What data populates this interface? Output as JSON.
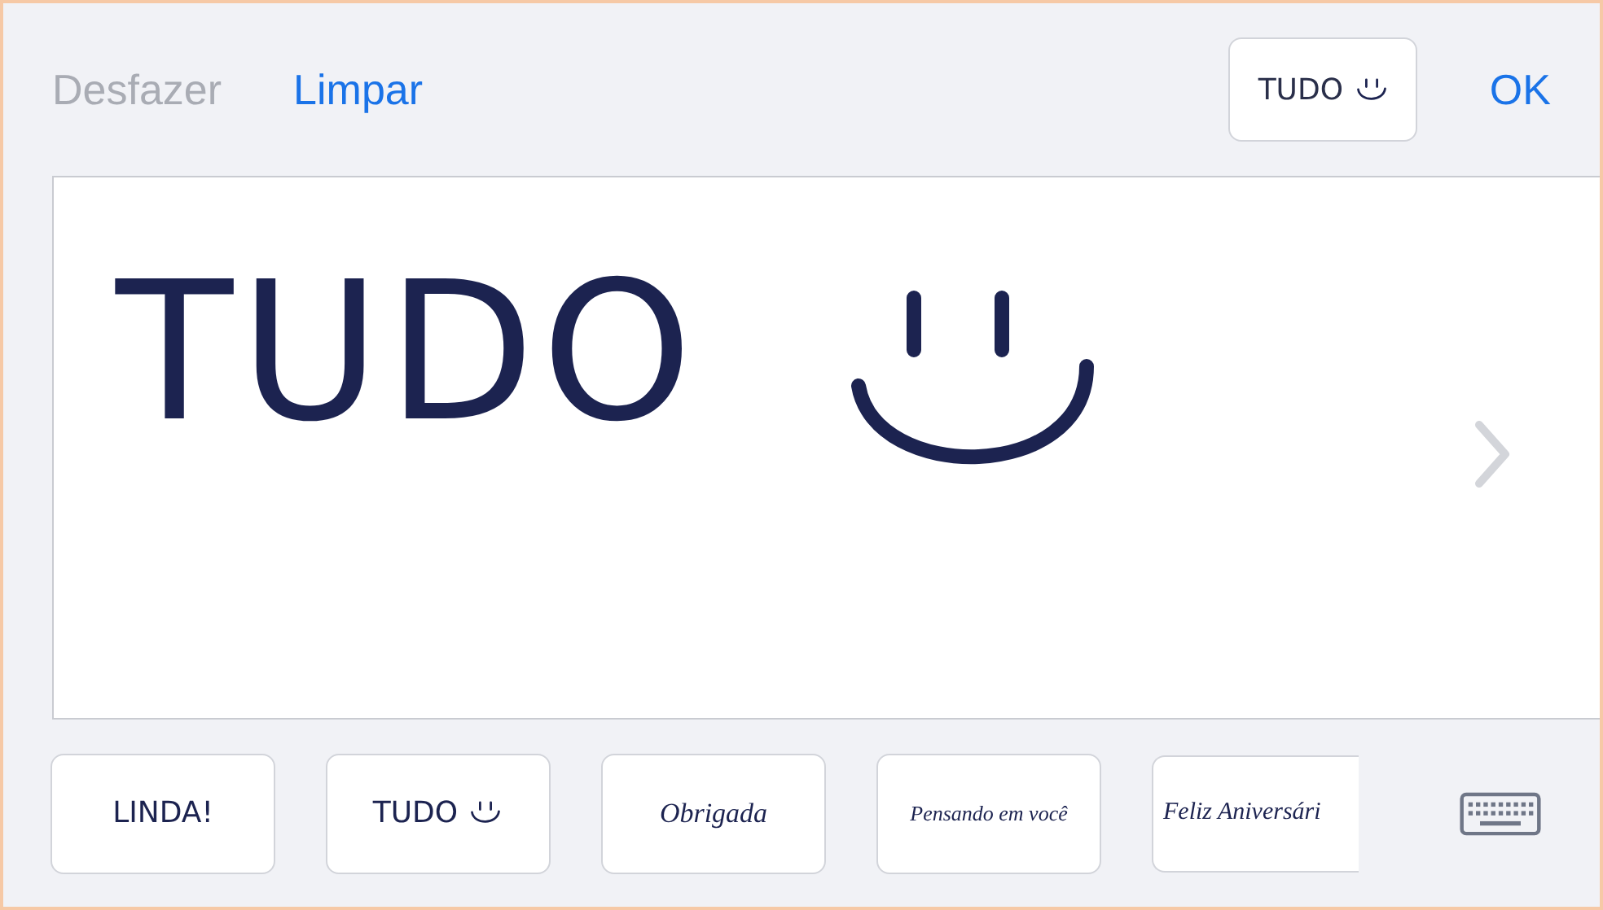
{
  "toolbar": {
    "undo": {
      "label": "Desfazer",
      "disabled": true
    },
    "clear": {
      "label": "Limpar",
      "disabled": false
    },
    "preview": {
      "text": "TUDO",
      "smiley": true
    },
    "done": {
      "label": "OK"
    }
  },
  "canvas": {
    "text": "TUDO",
    "smiley": true
  },
  "suggestions": [
    {
      "text": "LINDA!",
      "kind": "print",
      "smiley": false
    },
    {
      "text": "TUDO",
      "kind": "print",
      "smiley": true
    },
    {
      "text": "Obrigada",
      "kind": "script",
      "smiley": false
    },
    {
      "text": "Pensando em você",
      "kind": "script",
      "smiley": false
    },
    {
      "text": "Feliz Aniversári",
      "kind": "script",
      "smiley": false
    }
  ]
}
